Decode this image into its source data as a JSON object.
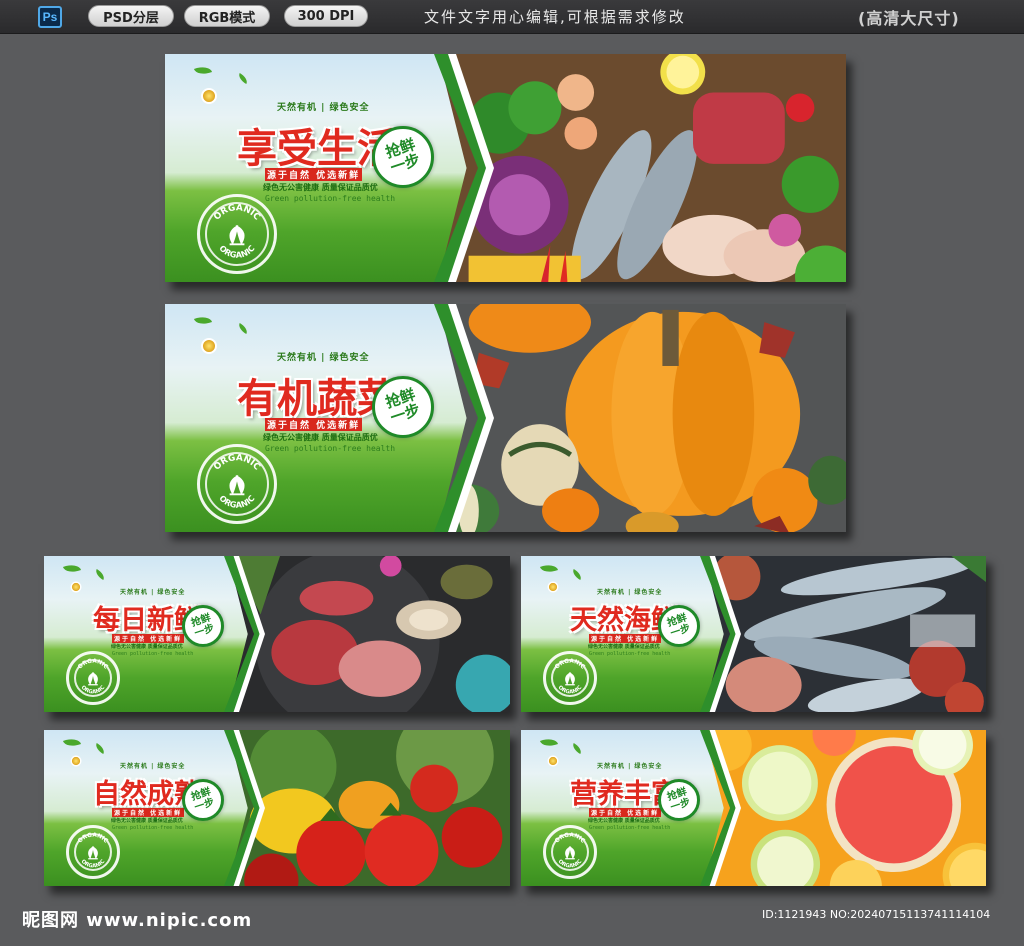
{
  "topbar": {
    "ps_label": "Ps",
    "pills": [
      "PSD分层",
      "RGB模式",
      "300 DPI"
    ],
    "notice": "文件文字用心编辑,可根据需求修改",
    "hd_label": "(高清大尺寸)"
  },
  "common": {
    "tagline": "天然有机 | 绿色安全",
    "subtitle": "源于自然 优选新鲜",
    "line2": "绿色无公害健康  质量保证品质优",
    "line3": "Green pollution-free health",
    "badge_text": "抢鲜\n一步",
    "organic_text": "ORGANIC"
  },
  "banners": [
    {
      "title": "享受生活",
      "photo": "mixed-fresh-food"
    },
    {
      "title": "有机蔬菜",
      "photo": "pumpkins"
    },
    {
      "title": "每日新鲜",
      "photo": "raw-meat-seafood"
    },
    {
      "title": "天然海鲜",
      "photo": "fresh-fish"
    },
    {
      "title": "自然成熟",
      "photo": "tomatoes"
    },
    {
      "title": "营养丰富",
      "photo": "citrus-slices"
    }
  ],
  "footer": {
    "logo": "昵图网",
    "url": "www.nipic.com",
    "id_text": "ID:1121943 NO:20240715113741114104"
  },
  "colors": {
    "title_red": "#e02a1f",
    "brand_green": "#1f8a28",
    "bg": "#5a5b5d"
  }
}
